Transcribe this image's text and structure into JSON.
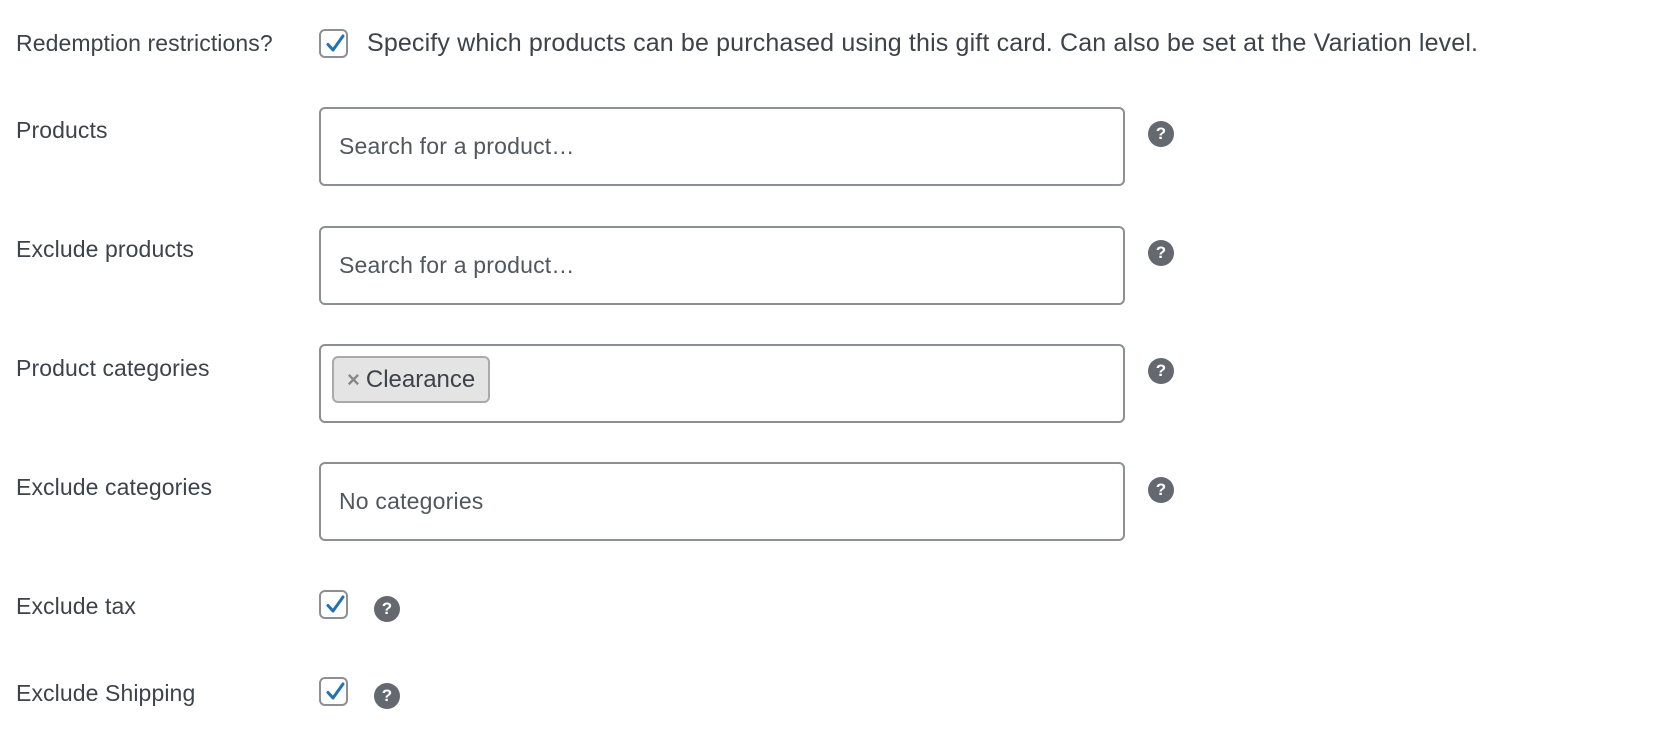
{
  "redemption": {
    "label": "Redemption restrictions?",
    "checked": true,
    "description": "Specify which products can be purchased using this gift card. Can also be set at the Variation level."
  },
  "products": {
    "label": "Products",
    "placeholder": "Search for a product…"
  },
  "exclude_products": {
    "label": "Exclude products",
    "placeholder": "Search for a product…"
  },
  "product_categories": {
    "label": "Product categories",
    "selected": [
      {
        "remove": "×",
        "label": "Clearance"
      }
    ]
  },
  "exclude_categories": {
    "label": "Exclude categories",
    "placeholder": "No categories"
  },
  "exclude_tax": {
    "label": "Exclude tax",
    "checked": true
  },
  "exclude_shipping": {
    "label": "Exclude Shipping",
    "checked": true
  },
  "help_icon": {
    "glyph": "?",
    "icon": "help-icon"
  },
  "colors": {
    "checkmark": "#2271b1",
    "text": "#3c434a",
    "border": "#8c8f94",
    "help_bg": "#646970",
    "chip_bg": "#e4e4e4"
  }
}
